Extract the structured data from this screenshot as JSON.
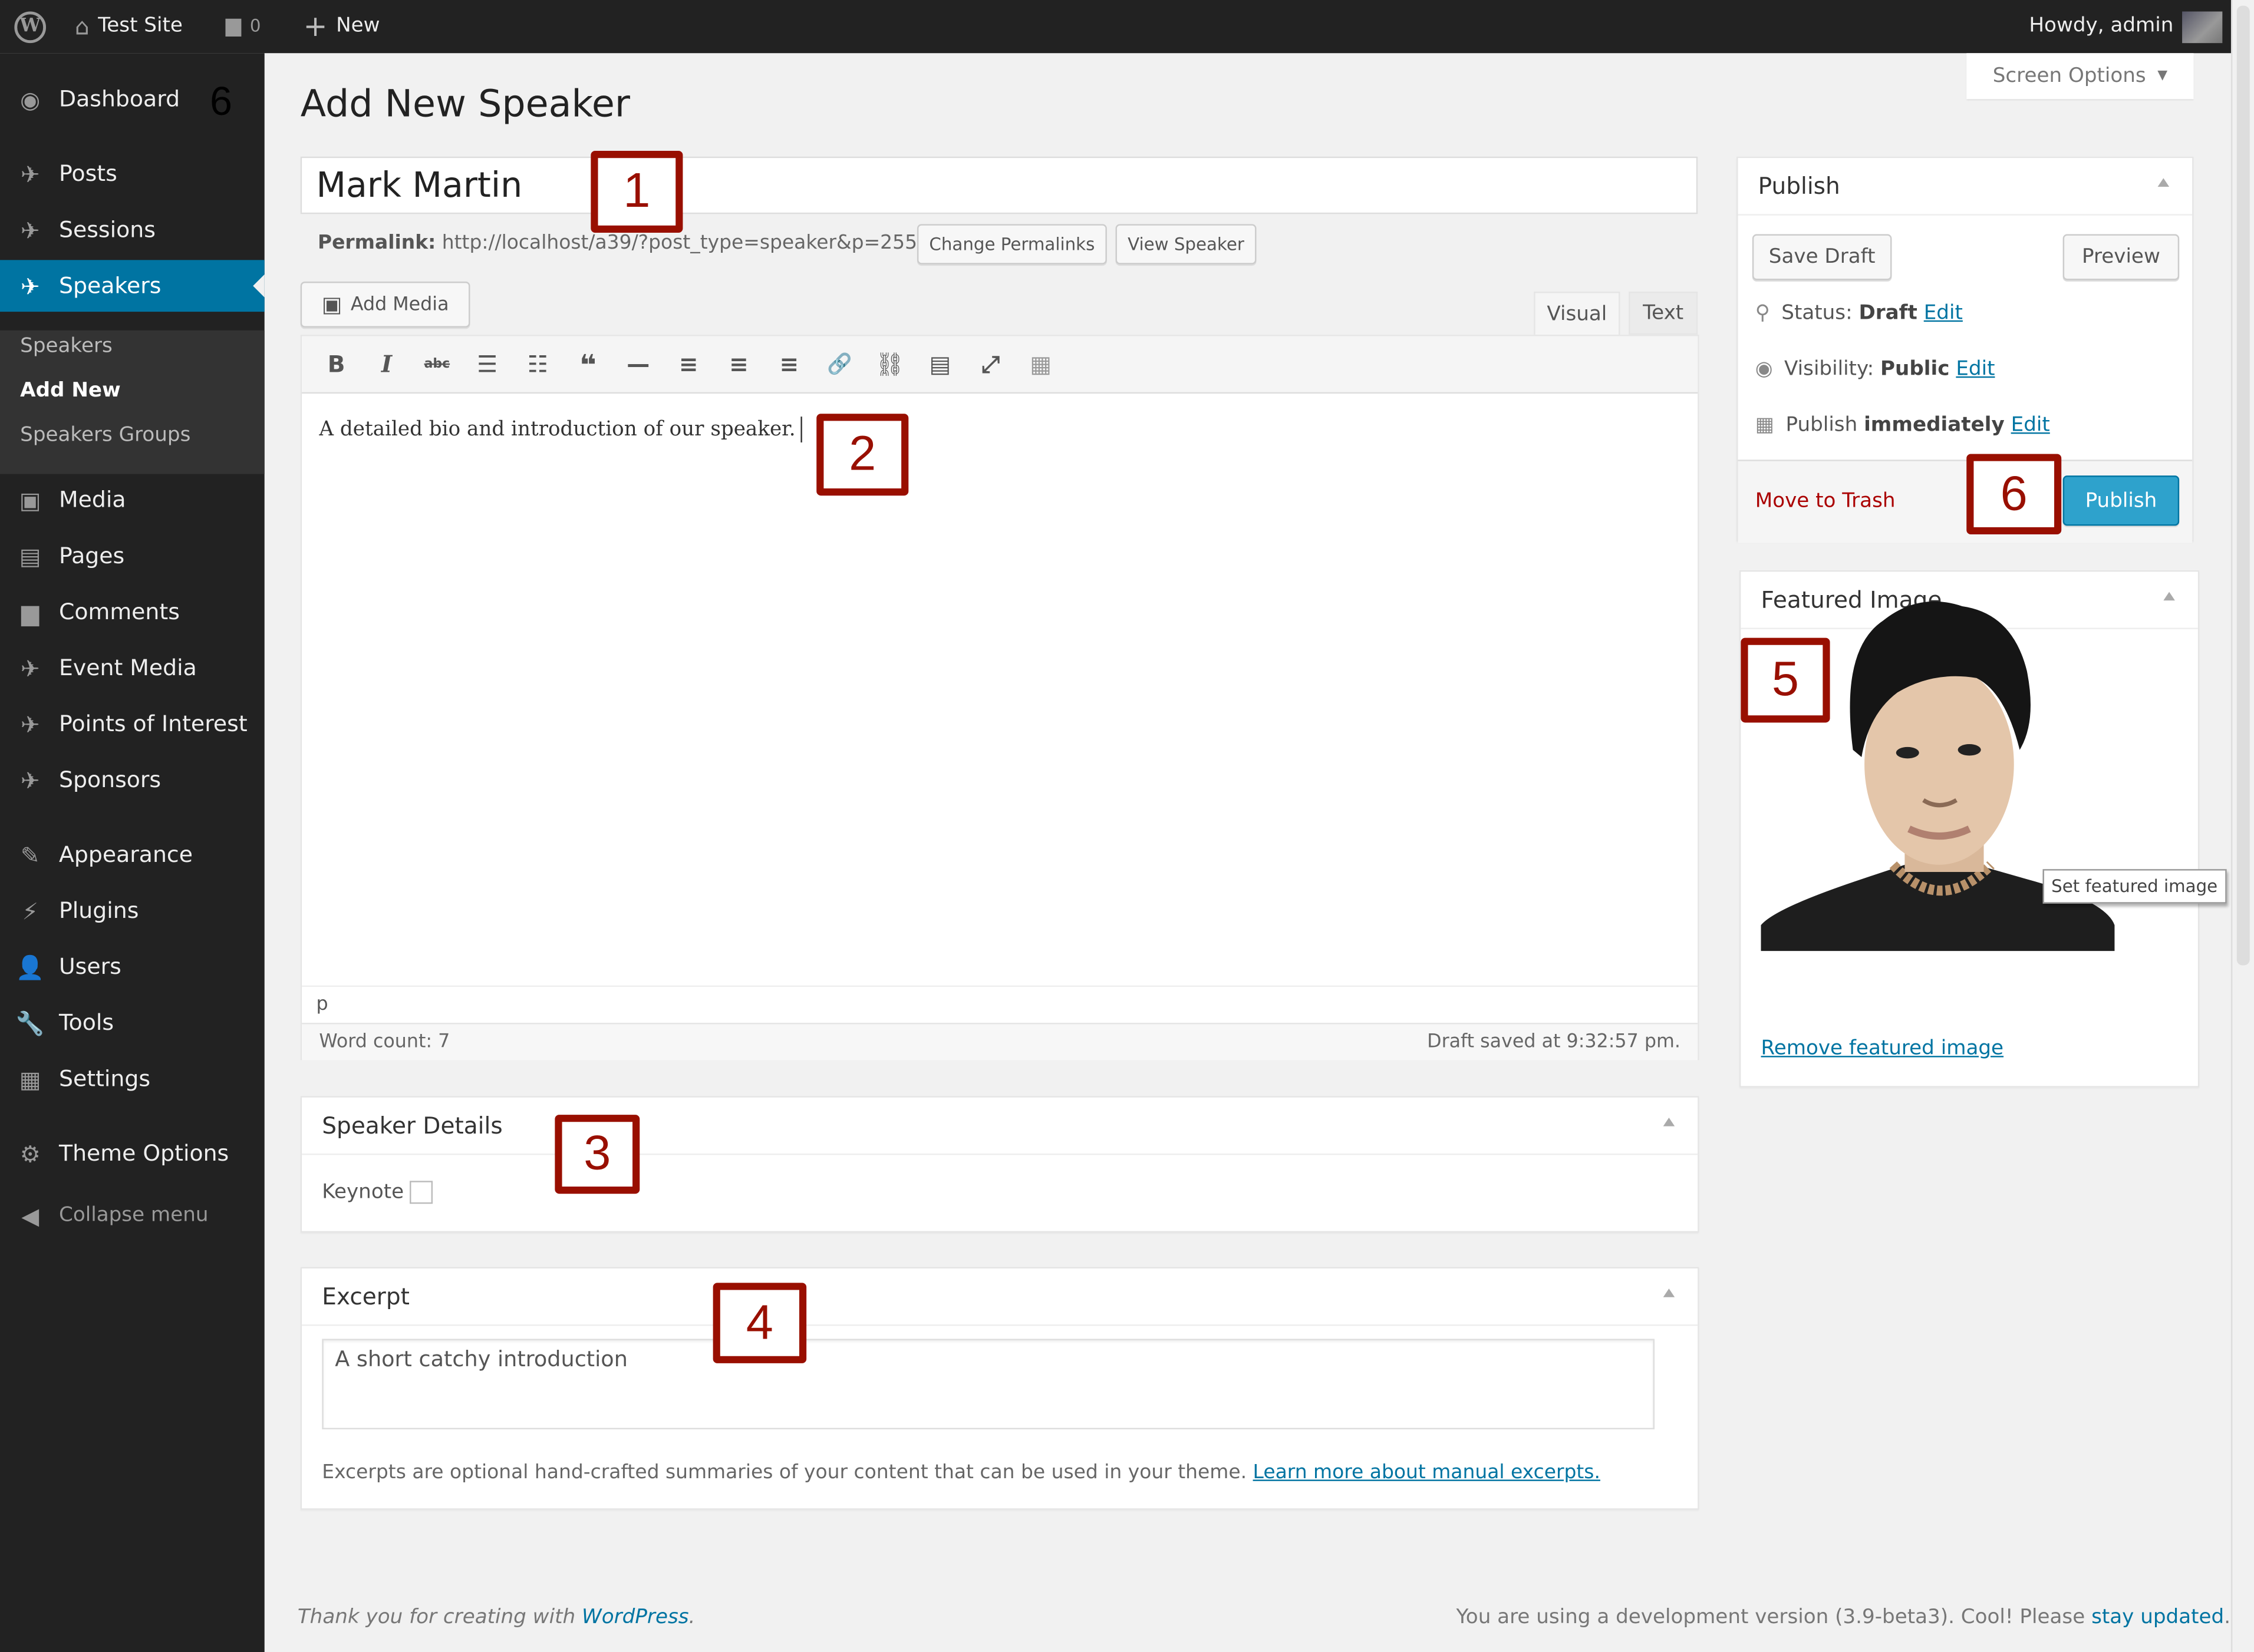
{
  "admin_bar": {
    "site_name": "Test Site",
    "comments_count": "0",
    "new_label": "New",
    "howdy": "Howdy, admin"
  },
  "sidebar": {
    "items": [
      {
        "label": "Dashboard",
        "icon": "dashboard-icon"
      },
      {
        "label": "Posts",
        "icon": "pin-icon"
      },
      {
        "label": "Sessions",
        "icon": "pin-icon"
      },
      {
        "label": "Speakers",
        "icon": "pin-icon",
        "current": true
      },
      {
        "label": "Media",
        "icon": "media-icon"
      },
      {
        "label": "Pages",
        "icon": "pages-icon"
      },
      {
        "label": "Comments",
        "icon": "comments-icon"
      },
      {
        "label": "Event Media",
        "icon": "pin-icon"
      },
      {
        "label": "Points of Interest",
        "icon": "pin-icon"
      },
      {
        "label": "Sponsors",
        "icon": "pin-icon"
      },
      {
        "label": "Appearance",
        "icon": "appearance-icon"
      },
      {
        "label": "Plugins",
        "icon": "plugins-icon"
      },
      {
        "label": "Users",
        "icon": "users-icon"
      },
      {
        "label": "Tools",
        "icon": "tools-icon"
      },
      {
        "label": "Settings",
        "icon": "settings-icon"
      },
      {
        "label": "Theme Options",
        "icon": "gear-icon"
      }
    ],
    "submenu": [
      {
        "label": "Speakers"
      },
      {
        "label": "Add New",
        "current": true
      },
      {
        "label": "Speakers Groups"
      }
    ],
    "collapse_label": "Collapse menu"
  },
  "screen_options": "Screen Options",
  "page_title": "Add New Speaker",
  "post_title": "Mark Martin",
  "permalink": {
    "label": "Permalink:",
    "url": "http://localhost/a39/?post_type=speaker&p=255",
    "change_button": "Change Permalinks",
    "view_button": "View Speaker"
  },
  "editor": {
    "add_media": "Add Media",
    "tabs": [
      "Visual",
      "Text"
    ],
    "active_tab": "Visual",
    "toolbar": [
      {
        "name": "bold-icon",
        "glyph": "B"
      },
      {
        "name": "italic-icon",
        "glyph": "I"
      },
      {
        "name": "strikethrough-icon",
        "glyph": "abc"
      },
      {
        "name": "bullet-list-icon",
        "glyph": "☰"
      },
      {
        "name": "numbered-list-icon",
        "glyph": "☷"
      },
      {
        "name": "blockquote-icon",
        "glyph": "❝"
      },
      {
        "name": "horizontal-rule-icon",
        "glyph": "—"
      },
      {
        "name": "align-left-icon",
        "glyph": "≡"
      },
      {
        "name": "align-center-icon",
        "glyph": "≡"
      },
      {
        "name": "align-right-icon",
        "glyph": "≡"
      },
      {
        "name": "link-icon",
        "glyph": "🔗"
      },
      {
        "name": "unlink-icon",
        "glyph": "⛓"
      },
      {
        "name": "insert-more-icon",
        "glyph": "▤"
      },
      {
        "name": "fullscreen-icon",
        "glyph": "⤢"
      },
      {
        "name": "kitchen-sink-icon",
        "glyph": "▦"
      }
    ],
    "content": "A detailed bio and introduction of our speaker.",
    "path": "p",
    "word_count": "Word count: 7",
    "draft_saved": "Draft saved at 9:32:57 pm."
  },
  "speaker_details": {
    "title": "Speaker Details",
    "keynote_label": "Keynote",
    "keynote_checked": false
  },
  "excerpt": {
    "title": "Excerpt",
    "value": "A short catchy introduction",
    "help": "Excerpts are optional hand-crafted summaries of your content that can be used in your theme.",
    "help_link": "Learn more about manual excerpts."
  },
  "publish": {
    "title": "Publish",
    "save_draft": "Save Draft",
    "preview": "Preview",
    "status_label": "Status:",
    "status_value": "Draft",
    "visibility_label": "Visibility:",
    "visibility_value": "Public",
    "schedule_label": "Publish",
    "schedule_value": "immediately",
    "edit": "Edit",
    "trash": "Move to Trash",
    "publish_button": "Publish"
  },
  "featured_image": {
    "title": "Featured Image",
    "tooltip": "Set featured image",
    "remove_link": "Remove featured image"
  },
  "annotations": [
    "1",
    "2",
    "3",
    "4",
    "5",
    "6",
    "6"
  ],
  "footer": {
    "left_text": "Thank you for creating with",
    "left_link": "WordPress",
    "right_text": "You are using a development version (3.9-beta3). Cool! Please",
    "right_link": "stay updated"
  },
  "colors": {
    "accent": "#0074a2",
    "annotation": "#990f00",
    "admin_bar": "#222222",
    "trash": "#a00000"
  }
}
